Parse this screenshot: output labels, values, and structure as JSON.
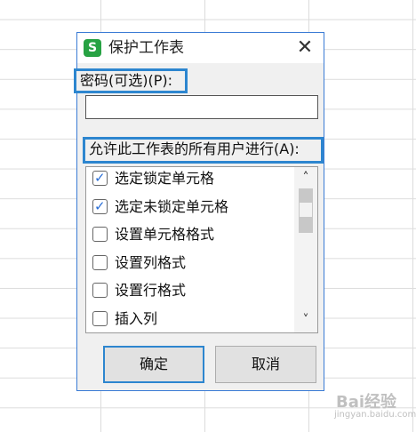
{
  "dialog": {
    "title": "保护工作表",
    "app_icon": "S",
    "close_glyph": "✕",
    "password_label": "密码(可选)(P):",
    "password_value": "",
    "allow_label": "允许此工作表的所有用户进行(A):",
    "permissions": [
      {
        "label": "选定锁定单元格",
        "checked": true
      },
      {
        "label": "选定未锁定单元格",
        "checked": true
      },
      {
        "label": "设置单元格格式",
        "checked": false
      },
      {
        "label": "设置列格式",
        "checked": false
      },
      {
        "label": "设置行格式",
        "checked": false
      },
      {
        "label": "插入列",
        "checked": false
      }
    ],
    "ok_label": "确定",
    "cancel_label": "取消"
  },
  "watermark": {
    "brand": "Bai经验",
    "url": "jingyan.baidu.com"
  },
  "icons": {
    "app": "wps-spreadsheet-icon",
    "close": "close-icon",
    "scroll_up": "chevron-up-icon",
    "scroll_down": "chevron-down-icon",
    "check": "checkmark-icon"
  },
  "colors": {
    "accent": "#2d86cf",
    "app_icon": "#27a243",
    "checkmark": "#2b6fd6",
    "dialog_bg": "#f0f0f0"
  }
}
